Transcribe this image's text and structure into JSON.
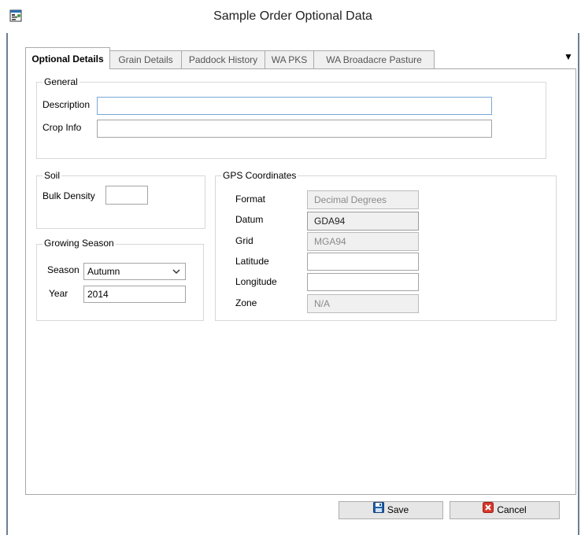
{
  "window": {
    "title": "Sample Order Optional Data"
  },
  "tabs": [
    {
      "label": "Optional Details"
    },
    {
      "label": "Grain Details"
    },
    {
      "label": "Paddock History"
    },
    {
      "label": "WA PKS"
    },
    {
      "label": "WA Broadacre Pasture"
    }
  ],
  "tab_dropdown_glyph": "▼",
  "close_glyph": "×",
  "general": {
    "title": "General",
    "description_label": "Description",
    "description_value": "",
    "crop_info_label": "Crop Info",
    "crop_info_value": ""
  },
  "soil": {
    "title": "Soil",
    "bulk_density_label": "Bulk Density",
    "bulk_density_value": ""
  },
  "growing_season": {
    "title": "Growing Season",
    "season_label": "Season",
    "season_value": "Autumn",
    "year_label": "Year",
    "year_value": "2014"
  },
  "gps": {
    "title": "GPS Coordinates",
    "format_label": "Format",
    "format_value": "Decimal Degrees",
    "datum_label": "Datum",
    "datum_value": "GDA94",
    "grid_label": "Grid",
    "grid_value": "MGA94",
    "latitude_label": "Latitude",
    "latitude_value": "",
    "longitude_label": "Longitude",
    "longitude_value": "",
    "zone_label": "Zone",
    "zone_value": "N/A"
  },
  "buttons": {
    "save_label": "Save",
    "cancel_label": "Cancel"
  },
  "icons": {
    "app": "app-window-icon",
    "save": "floppy-disk-icon",
    "cancel": "red-x-icon",
    "chevron": "chevron-down-icon"
  },
  "colors": {
    "frame": "#6b7f92",
    "focus_border": "#7aa7d6",
    "save_icon": "#1f5ea8",
    "cancel_icon": "#d9372b"
  }
}
